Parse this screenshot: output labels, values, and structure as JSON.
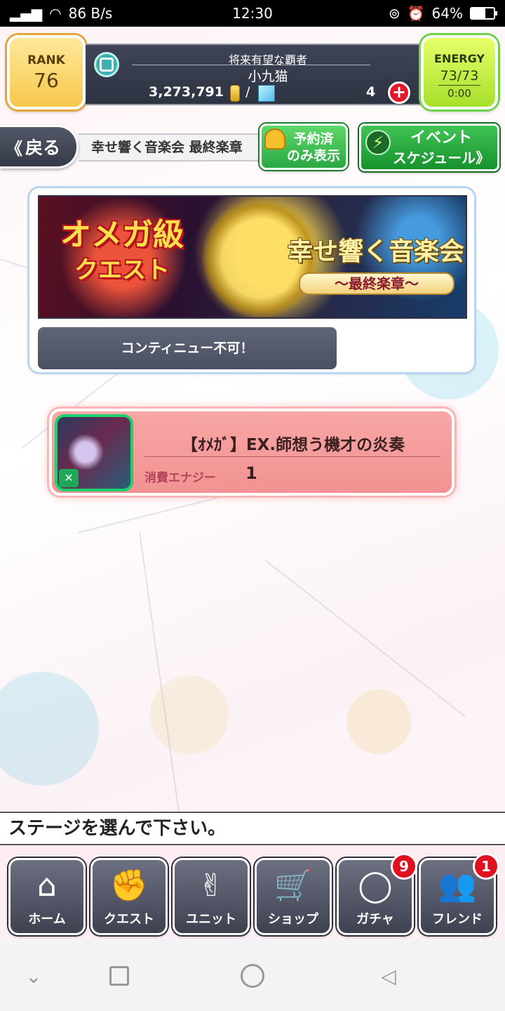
{
  "status_bar": {
    "network": "86 B/s",
    "time": "12:30",
    "battery": "64%",
    "battery_level": 0.64
  },
  "header": {
    "rank_label": "RANK",
    "rank_value": "76",
    "player_title": "将来有望な覇者",
    "player_name": "小九猫",
    "coins": "3,273,791",
    "slash": "/",
    "gems": "4",
    "plus": "+",
    "energy_label": "ENERGY",
    "energy_value": "73/73",
    "energy_timer": "0:00"
  },
  "nav": {
    "back_chevrons": "《",
    "back_label": "戻る",
    "event_title": "幸せ響く音楽会 最終楽章",
    "reserved_line1": "予約済",
    "reserved_line2": "のみ表示",
    "schedule_line1": "イベント",
    "schedule_line2": "スケジュール》"
  },
  "banner": {
    "left_title_1": "オメガ級",
    "left_title_2": "クエスト",
    "right_title": "幸せ響く音楽会",
    "right_sub": "〜最終楽章〜",
    "notice": "コンティニュー不可！"
  },
  "stage": {
    "title": "【ｵﾒｶﾞ】EX.師想う機才の炎奏",
    "cost_label": "消費エナジー",
    "cost_value": "1"
  },
  "prompt": "ステージを選んで下さい。",
  "tabs": [
    {
      "label": "ホーム",
      "icon": "⌂",
      "badge": ""
    },
    {
      "label": "クエスト",
      "icon": "✊",
      "badge": ""
    },
    {
      "label": "ユニット",
      "icon": "✌",
      "badge": ""
    },
    {
      "label": "ショップ",
      "icon": "🛒",
      "badge": ""
    },
    {
      "label": "ガチャ",
      "icon": "◯",
      "badge": "9"
    },
    {
      "label": "フレンド",
      "icon": "👥",
      "badge": "1"
    }
  ],
  "android_nav": {
    "back_icon": "◁",
    "home_icon": "○",
    "recents_icon": "□",
    "collapse_icon": "⌄"
  },
  "colors": {
    "rank_gold": "#f6c84b",
    "energy_green": "#a7e02a",
    "stage_pink": "#f29292",
    "button_green": "#2aa843",
    "badge_red": "#e0111f"
  }
}
